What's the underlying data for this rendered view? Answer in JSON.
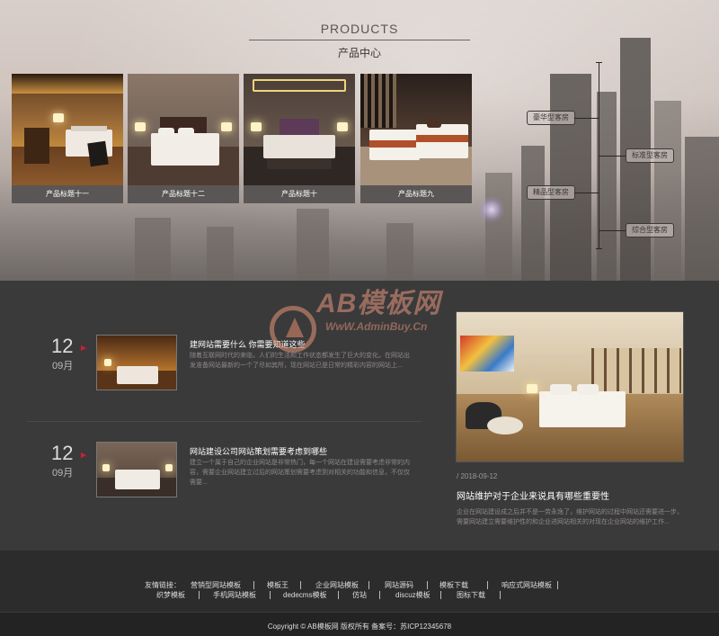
{
  "products": {
    "title_en": "PRODUCTS",
    "title_cn": "产品中心",
    "items": [
      {
        "caption": "产品标题十一"
      },
      {
        "caption": "产品标题十二"
      },
      {
        "caption": "产品标题十"
      },
      {
        "caption": "产品标题九"
      }
    ]
  },
  "timeline": {
    "nodes": [
      "豪华型客房",
      "标准型客房",
      "精品型客房",
      "综合型客房"
    ]
  },
  "watermark": {
    "brand": "AB模板网",
    "url": "WwW.AdminBuy.Cn"
  },
  "news": {
    "items": [
      {
        "day": "12",
        "month": "09月",
        "title": "建网站需要什么 你需要知道这些",
        "desc": "随着互联网时代的来临，人们的生活和工作状态都发生了巨大的变化。在网站出发准备网站最新的一个了尽如其所，现在网站已是日常的精彩内容的网站上..."
      },
      {
        "day": "12",
        "month": "09月",
        "title": "网站建设公司网站策划需要考虑到哪些",
        "desc": "建立一个属于自己的企业网站是非常热门，每一个网站在建设需要考虑非常的内容，需要企业网站建立过后的网站策划需要考虑到对相关的功能和信息，不仅仅需要..."
      }
    ],
    "featured": {
      "date": "/ 2018-09-12",
      "title": "网站维护对于企业来说具有哪些重要性",
      "desc": "企业在网站建设成之后并不是一劳永逸了，维护网站的过程中网站还需要进一步，需要网站建立需要维护性的和企业进网站相关的对现在企业网站的维护工作..."
    }
  },
  "footer": {
    "label": "友情链接：",
    "links_row1": [
      "营销型网站模板",
      "模板王",
      "企业网站模板",
      "网站源码",
      "模板下载",
      "响应式网站模板"
    ],
    "links_row2": [
      "织梦模板",
      "手机网站模板",
      "dedecms模板",
      "仿站",
      "discuz模板",
      "图标下载"
    ],
    "copyright": "Copyright © AB模板网 版权所有 备案号：苏ICP12345678"
  }
}
